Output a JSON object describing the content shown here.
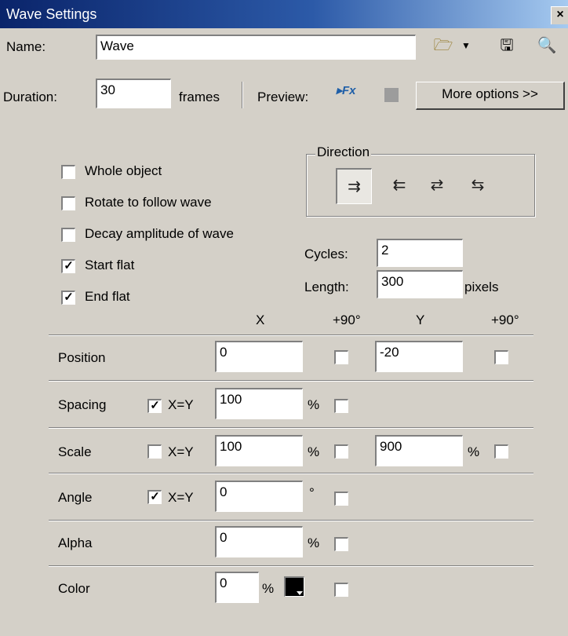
{
  "window": {
    "title": "Wave Settings",
    "close_glyph": "×"
  },
  "header": {
    "name_label": "Name:",
    "name_value": "Wave",
    "duration_label": "Duration:",
    "duration_value": "30",
    "frames_label": "frames",
    "preview_label": "Preview:",
    "more_options": "More options >>",
    "icons": [
      "open-folder-icon",
      "save-disk-icon",
      "search-icon",
      "play-fx-icon",
      "stop-icon"
    ]
  },
  "options": [
    {
      "label": "Whole object",
      "checked": false
    },
    {
      "label": "Rotate to follow wave",
      "checked": false
    },
    {
      "label": "Decay amplitude of wave",
      "checked": false
    },
    {
      "label": "Start flat",
      "checked": true
    },
    {
      "label": "End flat",
      "checked": true
    }
  ],
  "direction": {
    "label": "Direction",
    "buttons": [
      {
        "glyph": "⇉",
        "selected": true
      },
      {
        "glyph": "⇇",
        "selected": false
      },
      {
        "glyph": "⇄",
        "selected": false
      },
      {
        "glyph": "⇆",
        "selected": false
      }
    ]
  },
  "cycles": {
    "label": "Cycles:",
    "value": "2"
  },
  "length": {
    "label": "Length:",
    "value": "300",
    "unit": "pixels"
  },
  "columns": {
    "x": "X",
    "x_plus90": "+90°",
    "y": "Y",
    "y_plus90": "+90°"
  },
  "rows": {
    "position": {
      "label": "Position",
      "x": "0",
      "y": "-20"
    },
    "spacing": {
      "label": "Spacing",
      "link_label": "X=Y",
      "link_checked": true,
      "x": "100",
      "unit": "%"
    },
    "scale": {
      "label": "Scale",
      "link_label": "X=Y",
      "link_checked": false,
      "x": "100",
      "x_unit": "%",
      "y": "900",
      "y_unit": "%"
    },
    "angle": {
      "label": "Angle",
      "link_label": "X=Y",
      "link_checked": true,
      "x": "0",
      "unit": "°"
    },
    "alpha": {
      "label": "Alpha",
      "x": "0",
      "unit": "%"
    },
    "color": {
      "label": "Color",
      "x": "0",
      "unit": "%",
      "swatch_color": "#000000"
    }
  },
  "check_mark": "✓"
}
